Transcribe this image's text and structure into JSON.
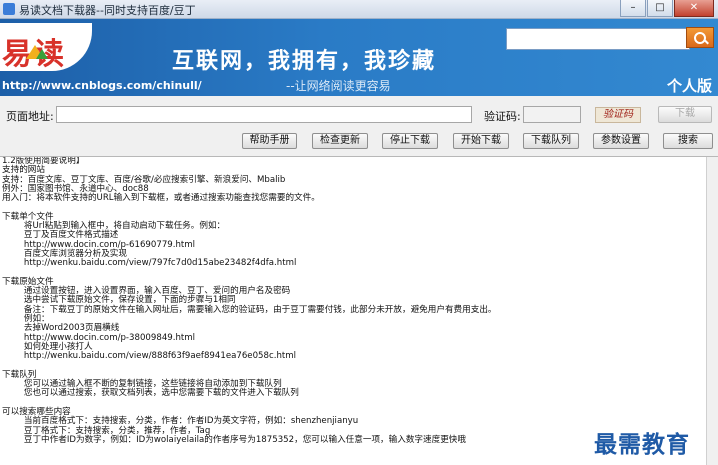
{
  "window": {
    "title": "易读文档下载器--同时支持百度/豆丁",
    "minimize_glyph": "–",
    "maximize_glyph": "□",
    "close_glyph": "✕"
  },
  "banner": {
    "logo_text": "易读",
    "url": "http://www.cnblogs.com/chinull/",
    "slogan": "互联网，我拥有，我珍藏",
    "subslogan": "--让网络阅读更容易",
    "edition": "个人版",
    "search_value": ""
  },
  "toolbar": {
    "page_address_label": "页面地址:",
    "page_address_value": "",
    "captcha_label": "验证码:",
    "captcha_value": "",
    "captcha_image_text": "验证码",
    "download_label": "下载",
    "buttons": {
      "help": "帮助手册",
      "check_update": "检查更新",
      "stop_download": "停止下载",
      "start_download": "开始下载",
      "download_queue": "下载队列",
      "param_settings": "参数设置",
      "search": "搜索"
    }
  },
  "log": {
    "lines": [
      "1.2版使用简要说明】",
      "支持的网站",
      "支持：百度文库、豆丁文库、百度/谷歌/必应搜索引擎、新浪爱问、Mbalib",
      "例外：国家图书馆、永道中心、doc88",
      "用入门：将本软件支持的URL输入到下载框，或者通过搜索功能查找您需要的文件。",
      "",
      "下载单个文件",
      "        将Url粘贴到输入框中，将自动启动下载任务。例如：",
      "        豆丁及百度文件格式描述",
      "        http://www.docin.com/p-61690779.html",
      "        百度文库浏览器分析及实现",
      "        http://wenku.baidu.com/view/797fc7d0d15abe23482f4dfa.html",
      "",
      "下载原始文件",
      "        通过设置按钮，进入设置界面，输入百度、豆丁、爱问的用户名及密码",
      "        选中尝试下载原始文件，保存设置，下面的步骤与1相同",
      "        备注：下载豆丁的原始文件在输入网址后，需要输入您的验证码，由于豆丁需要付钱，此部分未开放，避免用户有费用支出。",
      "        例如：",
      "        去掉Word2003页眉横线",
      "        http://www.docin.com/p-38009849.html",
      "        如何处理小孩打人",
      "        http://wenku.baidu.com/view/888f63f9aef8941ea76e058c.html",
      "",
      "下载队列",
      "        您可以通过输入框不断的复制链接，这些链接将自动添加到下载队列",
      "        您也可以通过搜索，获取文档列表，选中您需要下载的文件进入下载队列",
      "",
      "可以搜索哪些内容",
      "        当前百度格式下：支持搜索，分类，作者：作者ID为英文字符，例如：shenzhenjianyu",
      "        豆丁格式下：支持搜索，分类，推荐，作者，Tag",
      "        豆丁中作者ID为数字，例如：ID为wolaiyelaila的作者序号为1875352，您可以输入任意一项，输入数字速度更快哦"
    ]
  },
  "watermark": "最需教育"
}
